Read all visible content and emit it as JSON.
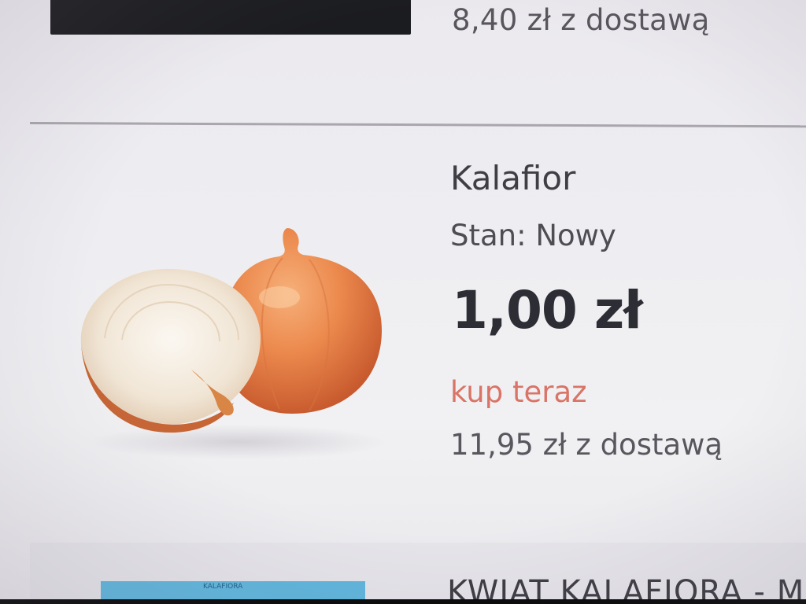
{
  "previous_listing": {
    "delivery_price": "8,40 zł z dostawą"
  },
  "listing": {
    "title": "Kalafior",
    "condition": "Stan: Nowy",
    "price": "1,00 zł",
    "buy_now_label": "kup teraz",
    "delivery_price": "11,95 zł z dostawą",
    "image_icon": "onion-image"
  },
  "next_listing": {
    "title": "KWIAT KALAFIORA - M",
    "thumbnail_label": "KALAFIORA"
  },
  "colors": {
    "price_text": "#2c2d35",
    "buy_now_accent": "#d97466",
    "secondary_text": "#58575e",
    "next_thumbnail": "#5fb6dd",
    "previous_thumbnail": "#1b1c1f"
  }
}
